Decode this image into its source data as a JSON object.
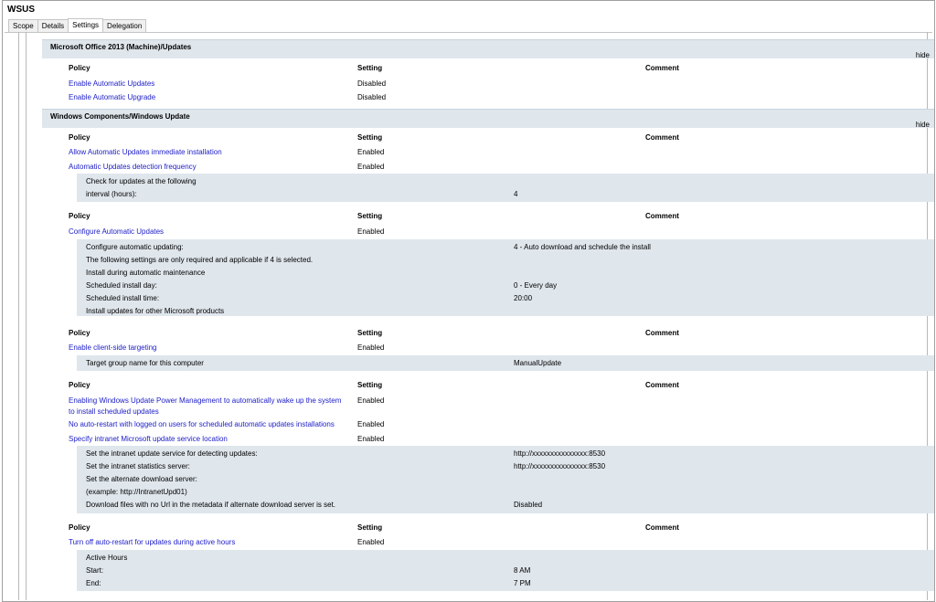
{
  "window": {
    "title": "WSUS"
  },
  "tabs": [
    {
      "label": "Scope"
    },
    {
      "label": "Details"
    },
    {
      "label": "Settings"
    },
    {
      "label": "Delegation"
    }
  ],
  "columns": {
    "policy": "Policy",
    "setting": "Setting",
    "comment": "Comment"
  },
  "hide_label": "hide",
  "sections": [
    {
      "title": "Microsoft Office 2013 (Machine)/Updates",
      "rows": [
        {
          "policy": "Enable Automatic Updates",
          "setting": "Disabled"
        },
        {
          "policy": "Enable Automatic Upgrade",
          "setting": "Disabled"
        }
      ]
    },
    {
      "title": "Windows Components/Windows Update",
      "groups": [
        {
          "rows": [
            {
              "policy": "Allow Automatic Updates immediate installation",
              "setting": "Enabled"
            },
            {
              "policy": "Automatic Updates detection frequency",
              "setting": "Enabled"
            }
          ],
          "details": [
            {
              "label": "Check for updates at the following",
              "value": ""
            },
            {
              "label": "interval (hours):",
              "value": "4"
            }
          ]
        },
        {
          "rows": [
            {
              "policy": "Configure Automatic Updates",
              "setting": "Enabled"
            }
          ],
          "details": [
            {
              "label": "Configure automatic updating:",
              "value": "4 - Auto download and schedule the install"
            },
            {
              "label": "The following settings are only required and applicable if 4 is selected.",
              "value": ""
            },
            {
              "label": "Install during automatic maintenance",
              "value": ""
            },
            {
              "label": "Scheduled install day:",
              "value": "0 - Every day"
            },
            {
              "label": "Scheduled install time:",
              "value": "20:00"
            },
            {
              "label": "Install updates for other Microsoft products",
              "value": ""
            }
          ]
        },
        {
          "rows": [
            {
              "policy": "Enable client-side targeting",
              "setting": "Enabled"
            }
          ],
          "details": [
            {
              "label": "Target group name for this computer",
              "value": "ManualUpdate"
            }
          ]
        },
        {
          "rows": [
            {
              "policy": "Enabling Windows Update Power Management to automatically wake up the system to install scheduled updates",
              "setting": "Enabled"
            },
            {
              "policy": "No auto-restart with logged on users for scheduled automatic updates installations",
              "setting": "Enabled"
            },
            {
              "policy": "Specify intranet Microsoft update service location",
              "setting": "Enabled"
            }
          ],
          "details": [
            {
              "label": "Set the intranet update service for detecting updates:",
              "value": "http://xxxxxxxxxxxxxxx:8530"
            },
            {
              "label": "Set the intranet statistics server:",
              "value": "http://xxxxxxxxxxxxxxx:8530"
            },
            {
              "label": "Set the alternate download server:",
              "value": ""
            },
            {
              "label": "(example: http://IntranetUpd01)",
              "value": ""
            },
            {
              "label": "Download files with no Url in the metadata if alternate download server is set.",
              "value": "Disabled"
            }
          ]
        },
        {
          "rows": [
            {
              "policy": "Turn off auto-restart for updates during active hours",
              "setting": "Enabled"
            }
          ],
          "details": [
            {
              "label": "Active Hours",
              "value": ""
            },
            {
              "label": "Start:",
              "value": "8 AM"
            },
            {
              "label": "End:",
              "value": "7 PM"
            }
          ]
        }
      ]
    }
  ]
}
